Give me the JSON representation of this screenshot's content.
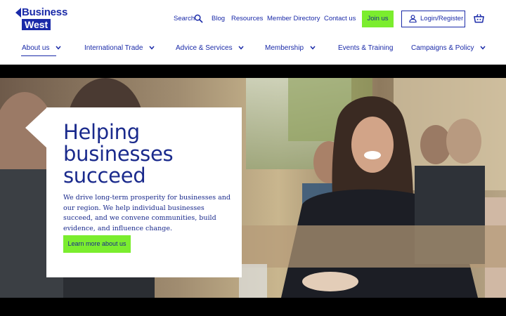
{
  "logo": {
    "line1": "Business",
    "line2": "West"
  },
  "utility_nav": {
    "search": "Search",
    "blog": "Blog",
    "resources": "Resources",
    "member_directory": "Member Directory",
    "contact": "Contact us",
    "join": "Join us",
    "login": "Login/Register"
  },
  "main_nav": [
    {
      "label": "About us",
      "has_dropdown": true
    },
    {
      "label": "International Trade",
      "has_dropdown": true
    },
    {
      "label": "Advice & Services",
      "has_dropdown": true
    },
    {
      "label": "Membership",
      "has_dropdown": true
    },
    {
      "label": "Events & Training",
      "has_dropdown": false
    },
    {
      "label": "Campaigns & Policy",
      "has_dropdown": true
    }
  ],
  "hero": {
    "headline": "Helping businesses succeed",
    "body": "We drive long-term prosperity for businesses and our region. We help individual businesses succeed, and we convene communities, build evidence, and influence change.",
    "cta": "Learn more about us"
  },
  "colors": {
    "brand_blue": "#1a2aa8",
    "accent_green": "#7bed2e",
    "text_navy": "#1a2a8c"
  },
  "icons": {
    "search": "search-icon",
    "login": "user-icon",
    "basket": "basket-icon",
    "dropdown": "chevron-down-icon"
  }
}
